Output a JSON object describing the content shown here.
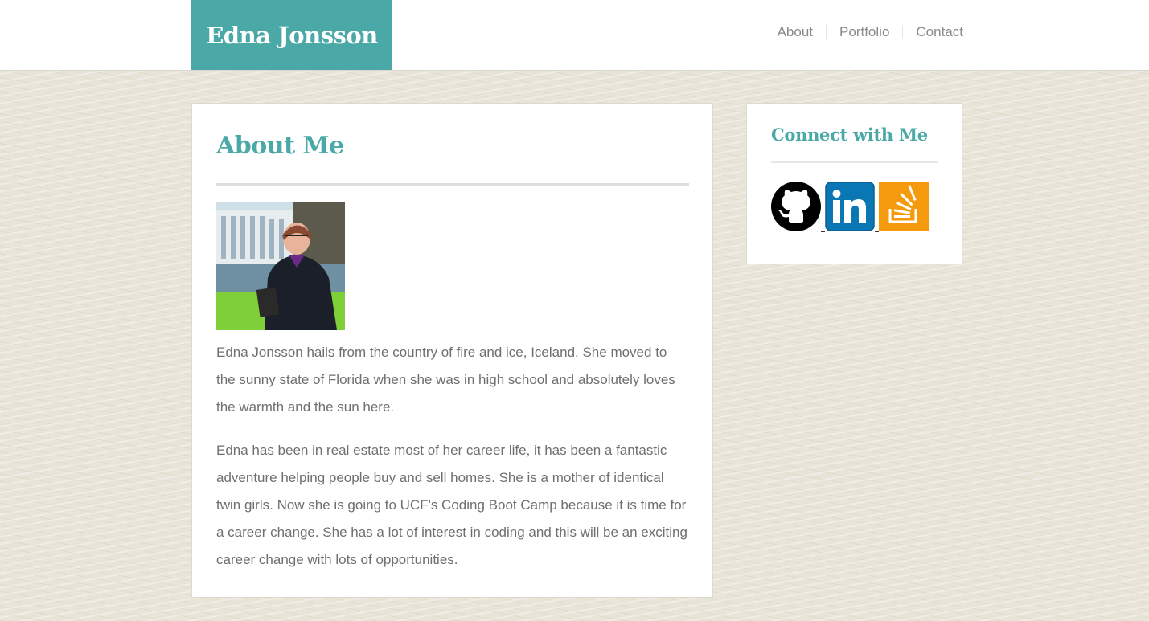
{
  "header": {
    "brand": "Edna Jonsson",
    "nav": [
      {
        "label": "About"
      },
      {
        "label": "Portfolio"
      },
      {
        "label": "Contact"
      }
    ]
  },
  "main": {
    "title": "About Me",
    "paragraphs": [
      "Edna Jonsson hails from the country of fire and ice, Iceland. She moved to the sunny state of Florida when she was in high school and absolutely loves the warmth and the sun here.",
      "Edna has been in real estate most of her career life, it has been a fantastic adventure helping people buy and sell homes. She is a mother of identical twin girls. Now she is going to UCF's Coding Boot Camp because it is time for a career change. She has a lot of interest in coding and this will be an exciting career change with lots of opportunities."
    ]
  },
  "sidebar": {
    "title": "Connect with Me",
    "links": [
      {
        "icon": "github-icon"
      },
      {
        "icon": "linkedin-icon"
      },
      {
        "icon": "stackoverflow-icon"
      }
    ]
  },
  "colors": {
    "accent": "#4aa8a6",
    "text": "#6f6f6f",
    "nav_text": "#8a8a8a",
    "background": "#e9e4d8",
    "linkedin": "#0a77b5",
    "stackoverflow": "#f59a0d"
  }
}
